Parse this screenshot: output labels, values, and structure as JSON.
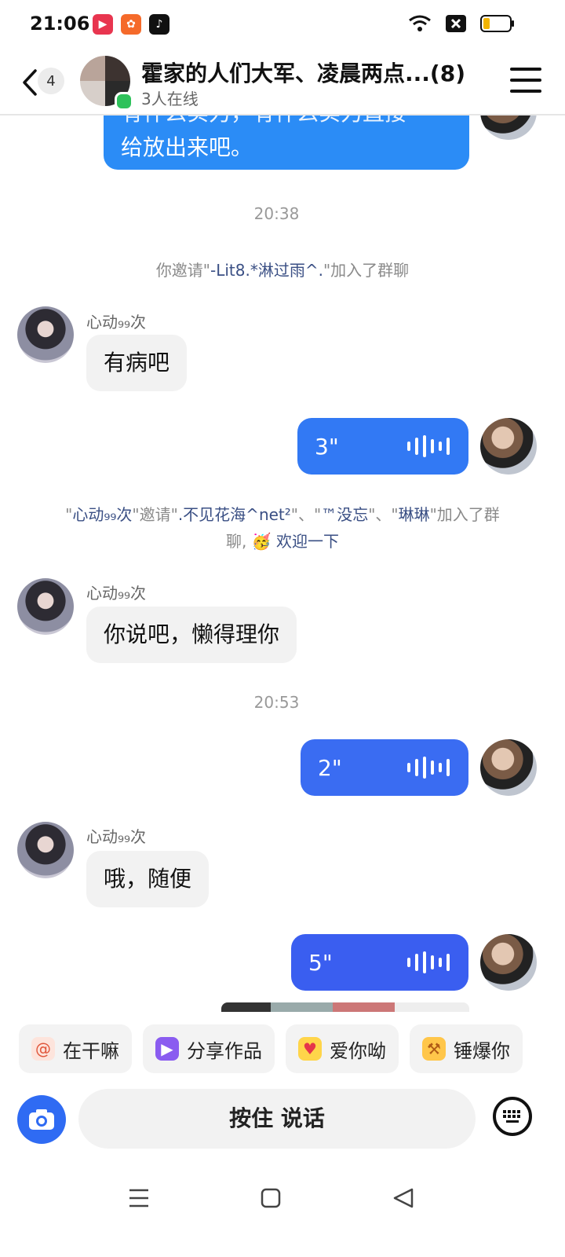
{
  "status_bar": {
    "time": "21:06"
  },
  "header": {
    "unread_count": "4",
    "title": "霍家的人们大军、凌晨两点...(8)",
    "online": "3人在线"
  },
  "messages": {
    "top_bubble_line1": "有什么实力，有什么实力直接",
    "top_bubble_line2": "给放出来吧。",
    "time1": "20:38",
    "sys1": {
      "prefix": "你邀请\"",
      "name": "-Lit8.*淋过雨^.",
      "suffix": "\"加入了群聊"
    },
    "sender": "心动₉₉次",
    "msg1": "有病吧",
    "voice1": "3\"",
    "sys2": {
      "q1": "\"",
      "inviter": "心动₉₉次",
      "mid": "\"邀请\"",
      "n1": ".不见花海^net²",
      "sep1": "\"、\"",
      "n2": "™没忘",
      "sep2": "\"、\"",
      "n3": "琳琳",
      "end1": "\"加入了群",
      "end2": "聊, ",
      "welcome": "欢迎一下"
    },
    "msg2": "你说吧，懒得理你",
    "time2": "20:53",
    "voice2": "2\"",
    "msg3": "哦，随便",
    "voice3": "5\""
  },
  "quick_replies": [
    {
      "label": "在干嘛",
      "icon": "snail-icon"
    },
    {
      "label": "分享作品",
      "icon": "video-share-icon"
    },
    {
      "label": "爱你呦",
      "icon": "heart-eyes-icon"
    },
    {
      "label": "锤爆你",
      "icon": "hammer-icon"
    }
  ],
  "input": {
    "voice_label": "按住 说话"
  },
  "colors": {
    "accent_blue": "#2b8cf6",
    "voice_blue": "#3279f4",
    "voice_indigo": "#3a5ef0",
    "online_green": "#2ec25b"
  }
}
